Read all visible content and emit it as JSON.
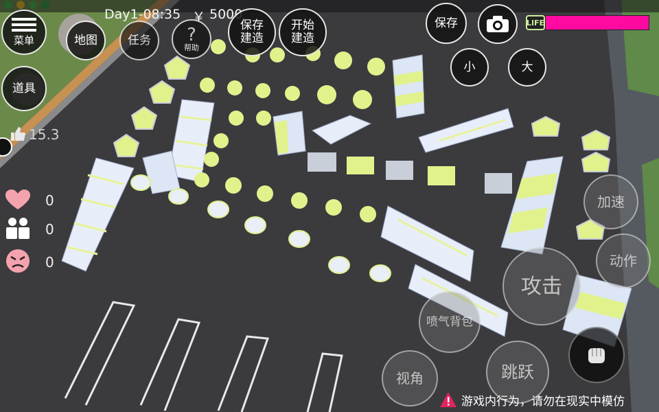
{
  "hud": {
    "day_time": "Day1-08:35",
    "currency_symbol": "￥",
    "money": "5000",
    "like_count": "15.3"
  },
  "left_menu": {
    "menu_label": "菜单",
    "map_label": "地图",
    "task_label": "任务",
    "help_label": "帮助",
    "items_label": "道具"
  },
  "build": {
    "save_build_line1": "保存",
    "save_build_line2": "建造",
    "start_build_line1": "开始",
    "start_build_line2": "建造"
  },
  "top_right": {
    "save_label": "保存",
    "life_label": "LIFE",
    "life_level": 1.0,
    "small_label": "小",
    "large_label": "大"
  },
  "stats": {
    "heart_count": "0",
    "friends_count": "0",
    "angry_count": "0"
  },
  "actions": {
    "accelerate_label": "加速",
    "action_label": "动作",
    "attack_label": "攻击",
    "jetpack_label": "喷气背包",
    "view_label": "视角",
    "jump_label": "跳跃"
  },
  "warning": {
    "text": "游戏内行为，请勿在现实中模仿"
  },
  "colors": {
    "life_bar": "#ff0aa0",
    "accent_green": "#dff58a"
  }
}
